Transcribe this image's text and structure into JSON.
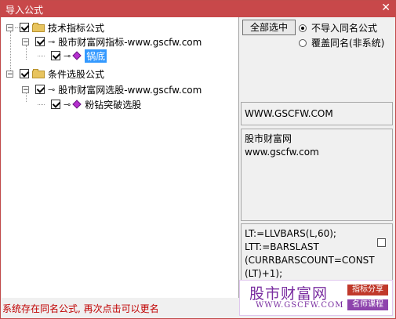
{
  "window": {
    "title": "导入公式",
    "close_glyph": "✕"
  },
  "tree": {
    "nodes": [
      {
        "label": "技术指标公式",
        "checked": true
      },
      {
        "label": "股市财富网指标-www.gscfw.com",
        "checked": true
      },
      {
        "label": "锅底",
        "checked": true,
        "selected": true
      },
      {
        "label": "条件选股公式",
        "checked": true
      },
      {
        "label": "股市财富网选股-www.gscfw.com",
        "checked": true
      },
      {
        "label": "粉钻突破选股",
        "checked": true
      }
    ],
    "expander_glyph": "−"
  },
  "options": {
    "select_all_label": "全部选中",
    "radio_no_import_label": "不导入同名公式",
    "radio_overwrite_label": "覆盖同名(非系统)"
  },
  "info": {
    "site_url": "WWW.GSCFW.COM",
    "description_line1": "股市财富网",
    "description_line2": "www.gscfw.com",
    "formula_text": "LT:=LLVBARS(L,60);\nLTT:=BARSLAST\n(CURRBARSCOUNT=CONST\n(LT)+1);"
  },
  "status": {
    "message": "系统存在同名公式, 再次点击可以更名"
  },
  "watermark": {
    "title": "股市财富网",
    "url": "WWW.GSCFW.COM",
    "tag_top": "指标分享",
    "tag_bottom": "名师课程",
    "color_tag_top": "#c0392b",
    "color_tag_bottom": "#8e44ad"
  }
}
